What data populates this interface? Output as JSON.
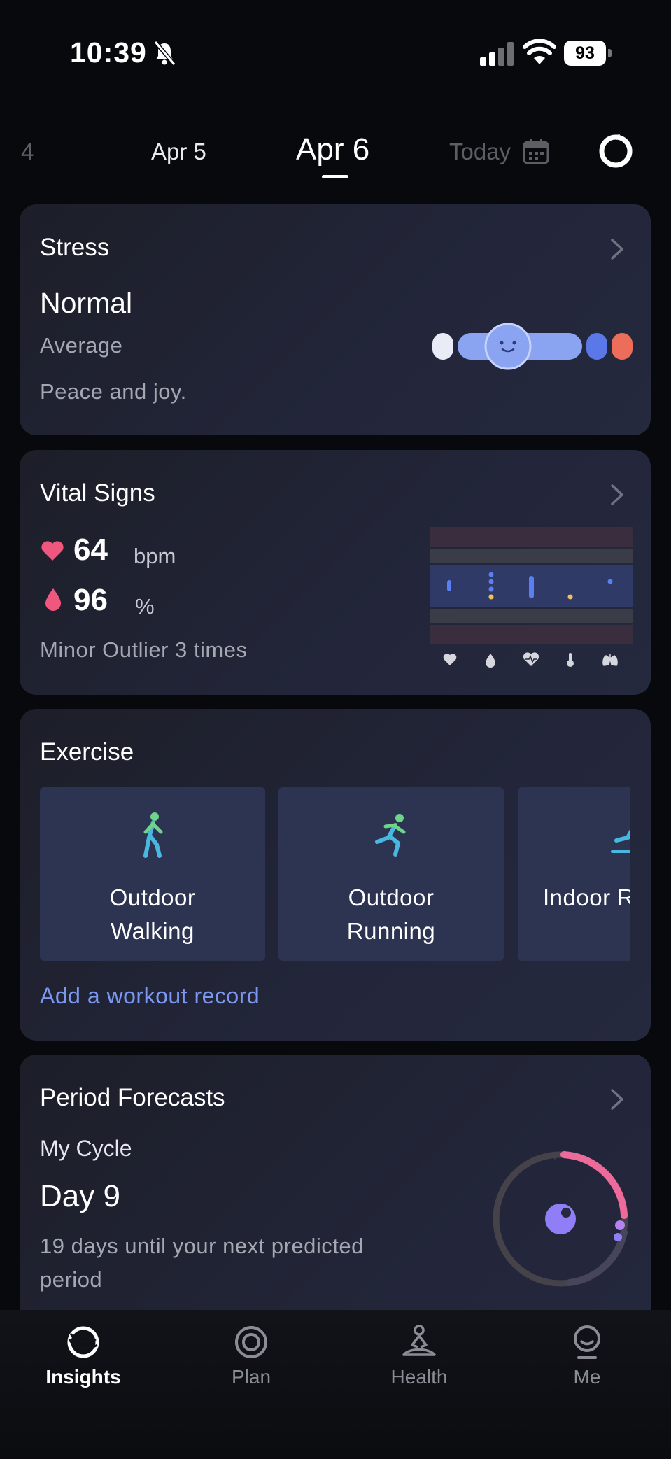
{
  "status_bar": {
    "time": "10:39",
    "battery": "93"
  },
  "date_nav": {
    "prev2": "4",
    "prev": "Apr 5",
    "current": "Apr 6",
    "today": "Today"
  },
  "stress": {
    "title": "Stress",
    "level": "Normal",
    "average": "Average",
    "message": "Peace and joy."
  },
  "vital_signs": {
    "title": "Vital Signs",
    "heart_rate": "64",
    "heart_rate_unit": "bpm",
    "spo2": "96",
    "spo2_unit": "%",
    "outlier": "Minor Outlier 3 times"
  },
  "exercise": {
    "title": "Exercise",
    "tiles": [
      {
        "line1": "Outdoor",
        "line2": "Walking",
        "icon": "walking-icon"
      },
      {
        "line1": "Outdoor",
        "line2": "Running",
        "icon": "running-icon"
      },
      {
        "line1": "Indoor R",
        "line2": "",
        "icon": "treadmill-icon"
      }
    ],
    "add_record": "Add a workout record"
  },
  "period": {
    "title": "Period Forecasts",
    "cycle_label": "My Cycle",
    "day": "Day 9",
    "message": "19 days until your next predicted period"
  },
  "tabs": [
    {
      "label": "Insights",
      "active": true
    },
    {
      "label": "Plan",
      "active": false
    },
    {
      "label": "Health",
      "active": false
    },
    {
      "label": "Me",
      "active": false
    }
  ],
  "colors": {
    "accent_blue": "#7b97ef",
    "heart_pink": "#f0577f",
    "stress_face": "#8aa4f2",
    "cycle_pink": "#ec6b9b",
    "cycle_purple": "#8f7ef5"
  }
}
